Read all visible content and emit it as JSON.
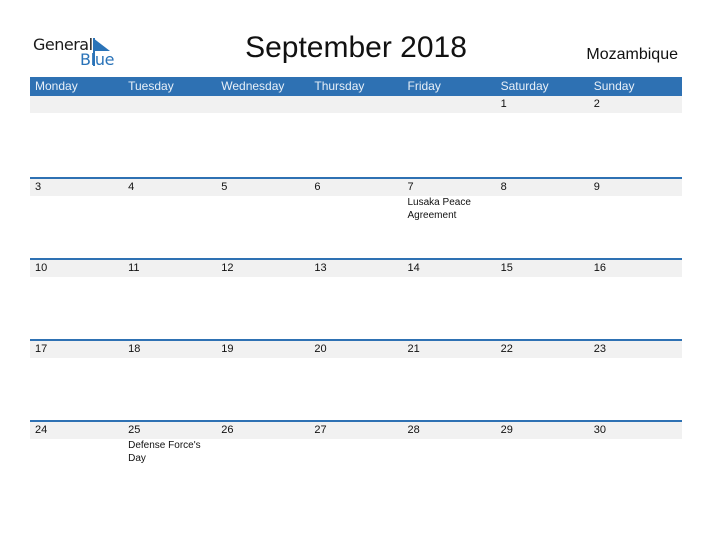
{
  "logo": {
    "line1": "General",
    "line2": "Blue"
  },
  "title": "September 2018",
  "country": "Mozambique",
  "weekdays": [
    "Monday",
    "Tuesday",
    "Wednesday",
    "Thursday",
    "Friday",
    "Saturday",
    "Sunday"
  ],
  "weeks": [
    [
      {
        "day": "",
        "event": ""
      },
      {
        "day": "",
        "event": ""
      },
      {
        "day": "",
        "event": ""
      },
      {
        "day": "",
        "event": ""
      },
      {
        "day": "",
        "event": ""
      },
      {
        "day": "1",
        "event": ""
      },
      {
        "day": "2",
        "event": ""
      }
    ],
    [
      {
        "day": "3",
        "event": ""
      },
      {
        "day": "4",
        "event": ""
      },
      {
        "day": "5",
        "event": ""
      },
      {
        "day": "6",
        "event": ""
      },
      {
        "day": "7",
        "event": "Lusaka Peace Agreement"
      },
      {
        "day": "8",
        "event": ""
      },
      {
        "day": "9",
        "event": ""
      }
    ],
    [
      {
        "day": "10",
        "event": ""
      },
      {
        "day": "11",
        "event": ""
      },
      {
        "day": "12",
        "event": ""
      },
      {
        "day": "13",
        "event": ""
      },
      {
        "day": "14",
        "event": ""
      },
      {
        "day": "15",
        "event": ""
      },
      {
        "day": "16",
        "event": ""
      }
    ],
    [
      {
        "day": "17",
        "event": ""
      },
      {
        "day": "18",
        "event": ""
      },
      {
        "day": "19",
        "event": ""
      },
      {
        "day": "20",
        "event": ""
      },
      {
        "day": "21",
        "event": ""
      },
      {
        "day": "22",
        "event": ""
      },
      {
        "day": "23",
        "event": ""
      }
    ],
    [
      {
        "day": "24",
        "event": ""
      },
      {
        "day": "25",
        "event": "Defense Force's Day"
      },
      {
        "day": "26",
        "event": ""
      },
      {
        "day": "27",
        "event": ""
      },
      {
        "day": "28",
        "event": ""
      },
      {
        "day": "29",
        "event": ""
      },
      {
        "day": "30",
        "event": ""
      }
    ]
  ],
  "colors": {
    "accent": "#2e71b3",
    "band": "#f1f1f1"
  }
}
